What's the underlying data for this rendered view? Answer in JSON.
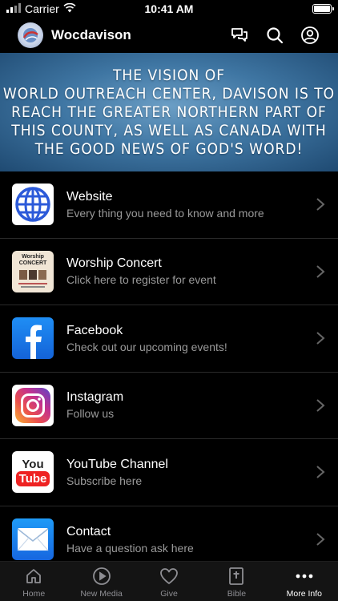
{
  "status_bar": {
    "carrier": "Carrier",
    "time": "10:41 AM",
    "battery_level": 1.0
  },
  "header": {
    "app_name": "Wocdavison",
    "icons": [
      "chat-bubbles-icon",
      "search-icon",
      "profile-icon"
    ]
  },
  "banner": {
    "lines": [
      "The Vision of",
      "World Outreach Center, Davison is to",
      "reach the greater northern part of",
      "this county, as well as Canada with",
      "the good news of God's word!"
    ]
  },
  "items": [
    {
      "title": "Website",
      "subtitle": "Every thing you need to know and more",
      "icon": "globe-icon"
    },
    {
      "title": "Worship Concert",
      "subtitle": "Click here to register for event",
      "icon": "worship-concert-flyer"
    },
    {
      "title": "Facebook",
      "subtitle": "Check out our upcoming events!",
      "icon": "facebook-icon"
    },
    {
      "title": "Instagram",
      "subtitle": "Follow us",
      "icon": "instagram-icon"
    },
    {
      "title": "YouTube Channel",
      "subtitle": "Subscribe here",
      "icon": "youtube-icon"
    },
    {
      "title": "Contact",
      "subtitle": "Have a question ask here",
      "icon": "mail-icon"
    }
  ],
  "flyer": {
    "heading": "Worship",
    "subheading": "CONCERT"
  },
  "youtube": {
    "top": "You",
    "bottom": "Tube"
  },
  "tabs": [
    {
      "label": "Home",
      "icon": "home-icon",
      "active": false
    },
    {
      "label": "New Media",
      "icon": "play-icon",
      "active": false
    },
    {
      "label": "Give",
      "icon": "heart-icon",
      "active": false
    },
    {
      "label": "Bible",
      "icon": "bible-icon",
      "active": false
    },
    {
      "label": "More Info",
      "icon": "more-icon",
      "active": true
    }
  ],
  "colors": {
    "background": "#000000",
    "accent": "#ffffff",
    "subtitle": "#9a9a9a",
    "tab_inactive": "#8e8e93"
  }
}
